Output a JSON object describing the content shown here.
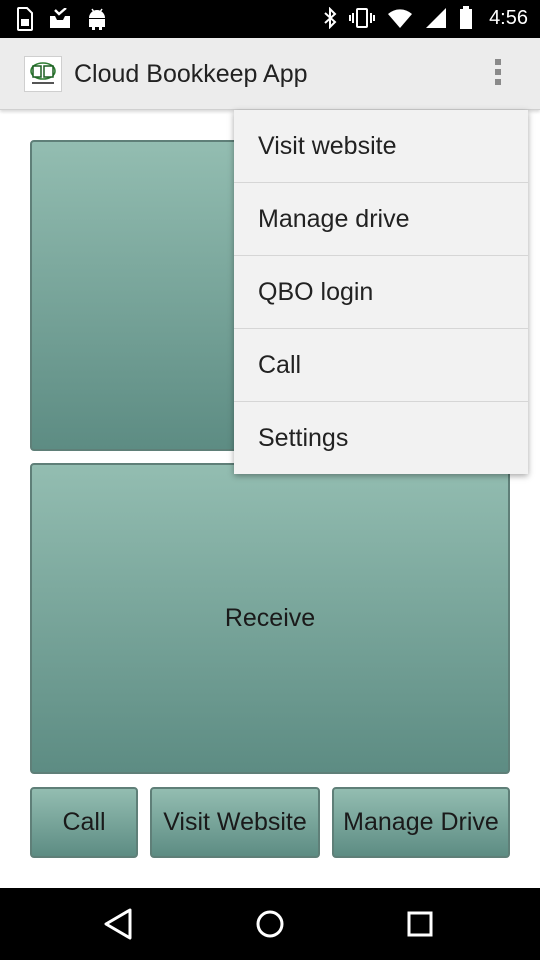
{
  "status_bar": {
    "time": "4:56",
    "icons": [
      "sim-card-icon",
      "inbox-check-icon",
      "android-icon",
      "bluetooth-icon",
      "vibrate-icon",
      "wifi-icon",
      "cell-signal-icon",
      "battery-icon"
    ]
  },
  "toolbar": {
    "title": "Cloud Bookkeep App",
    "logo_icon": "app-logo-icon",
    "overflow_icon": "more-vertical-icon"
  },
  "main": {
    "receive_label": "Receive"
  },
  "bottom_buttons": {
    "call": "Call",
    "visit_website": "Visit Website",
    "manage_drive": "Manage Drive"
  },
  "menu": {
    "items": [
      {
        "label": "Visit website"
      },
      {
        "label": "Manage drive"
      },
      {
        "label": "QBO login"
      },
      {
        "label": "Call"
      },
      {
        "label": "Settings"
      }
    ]
  },
  "nav_bar": {
    "icons": [
      "back-icon",
      "home-icon",
      "recents-icon"
    ]
  },
  "colors": {
    "tile_top": "#93bdb1",
    "tile_bottom": "#5d8c83",
    "toolbar": "#ececec",
    "menu_bg": "#f2f2f2"
  }
}
